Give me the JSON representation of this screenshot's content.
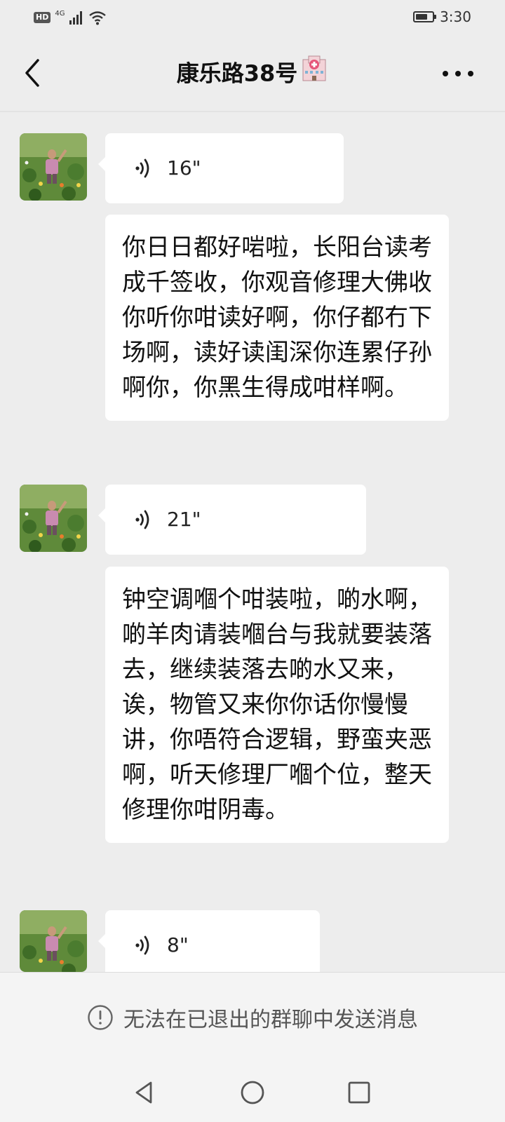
{
  "status_bar": {
    "hd_badge": "HD",
    "network": "4G",
    "time": "3:30",
    "battery_level": 0.6
  },
  "header": {
    "title": "康乐路38号",
    "title_emoji": "hospital-emoji",
    "back_icon": "chevron-left-icon",
    "more_icon": "more-dots-icon"
  },
  "messages": [
    {
      "type": "voice",
      "duration": "16\""
    },
    {
      "type": "text",
      "text": "你日日都好啱啦，长阳台读考成千签收，你观音修理大佛收你听你咁读好啊，你仔都冇下场啊，读好读闺深你连累仔孙啊你，你黑生得成咁样啊。"
    },
    {
      "type": "voice",
      "duration": "21\""
    },
    {
      "type": "text",
      "text": "钟空调嗰个咁装啦，啲水啊，啲羊肉请装嗰台与我就要装落去，继续装落去啲水又来，诶，物管又来你你话你慢慢讲，你唔符合逻辑，野蛮夹恶啊，听天修理厂嗰个位，整天修理你咁阴毒。"
    },
    {
      "type": "voice",
      "duration": "8\""
    }
  ],
  "footer": {
    "notice": "无法在已退出的群聊中发送消息",
    "notice_icon": "info-circle-icon"
  },
  "system_nav": {
    "back": "triangle-back-icon",
    "home": "circle-home-icon",
    "recents": "square-recents-icon"
  },
  "colors": {
    "background": "#ededed",
    "bubble": "#ffffff",
    "text": "#111111",
    "footer_bg": "#f4f4f4"
  }
}
